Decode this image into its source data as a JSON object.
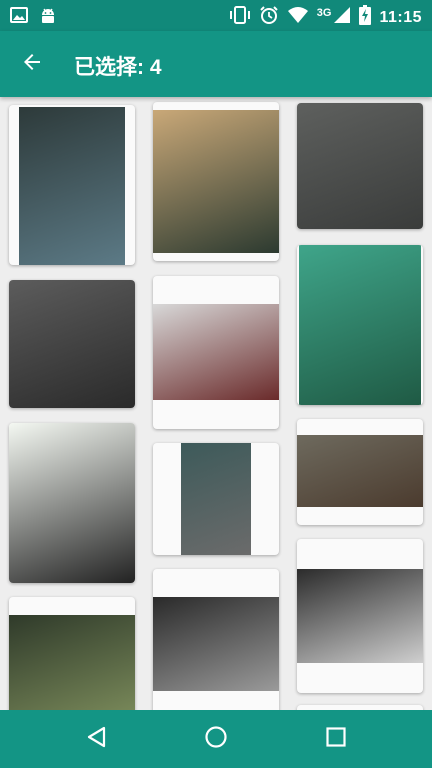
{
  "status_bar": {
    "network_label": "3G",
    "time": "11:15",
    "icons": [
      "image-notification-icon",
      "android-notification-icon",
      "vibrate-icon",
      "alarm-icon",
      "wifi-icon",
      "cell-signal-icon",
      "battery-charging-icon"
    ]
  },
  "app_bar": {
    "title": "已选择: 4",
    "back_icon": "arrow-back-icon"
  },
  "gallery": {
    "photos": [
      {
        "name": "photo-dark-fantasy-warrior",
        "colors": [
          "#2d3a3a",
          "#5c7a86"
        ]
      },
      {
        "name": "photo-girl-illustration",
        "colors": [
          "#c9a878",
          "#2c3a30"
        ]
      },
      {
        "name": "photo-kneeling-swordsman",
        "colors": [
          "#5e605e",
          "#3a3c3b"
        ]
      },
      {
        "name": "photo-wolf-mask",
        "colors": [
          "#5c5c5c",
          "#2a2a2a"
        ]
      },
      {
        "name": "photo-ipod-classic",
        "colors": [
          "#d8d8d8",
          "#6a2a2a"
        ]
      },
      {
        "name": "photo-owl-illustration",
        "colors": [
          "#3fa58a",
          "#1f5a44"
        ]
      },
      {
        "name": "photo-anime-soldier-girl",
        "colors": [
          "#f4f8f2",
          "#222222"
        ]
      },
      {
        "name": "photo-forest-ruins",
        "colors": [
          "#3d5a5a",
          "#6b6b6b"
        ]
      },
      {
        "name": "photo-ruined-room",
        "colors": [
          "#6e6a5e",
          "#4b3b2e"
        ]
      },
      {
        "name": "photo-phone-on-desk",
        "colors": [
          "#2f3a2a",
          "#7a8a5a"
        ]
      },
      {
        "name": "photo-speaker-closeup",
        "colors": [
          "#2a2a2a",
          "#9a9a9a"
        ]
      },
      {
        "name": "photo-speaker-bar",
        "colors": [
          "#2b2b2b",
          "#cfcfcf"
        ]
      }
    ]
  },
  "nav_bar": {
    "back": "back-triangle-icon",
    "home": "home-circle-icon",
    "recents": "recents-square-icon"
  }
}
